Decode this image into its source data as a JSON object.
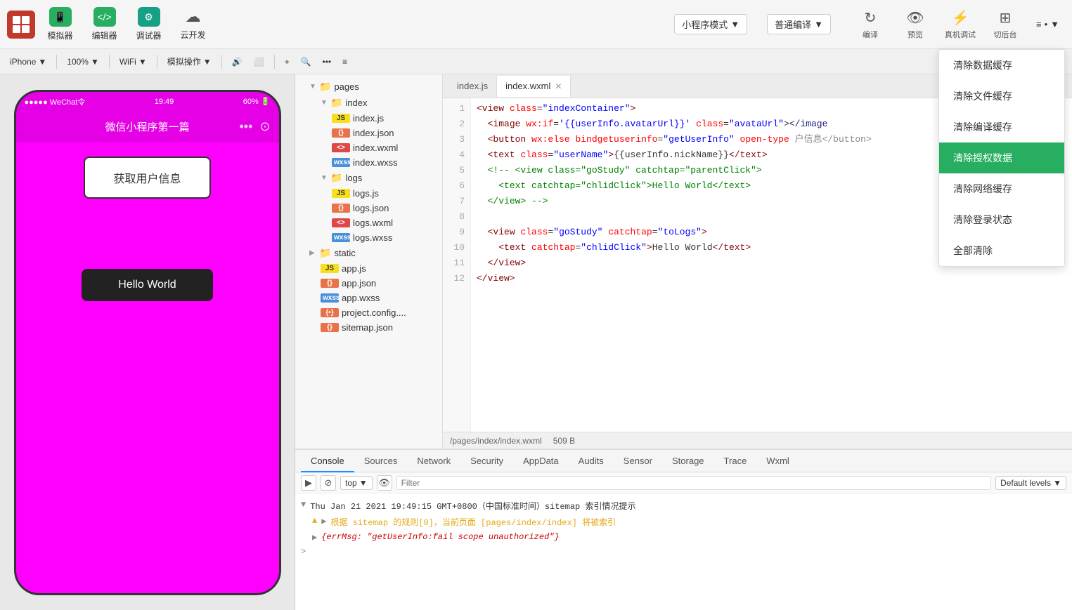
{
  "toolbar": {
    "logo": "W",
    "simulator_label": "模拟器",
    "editor_label": "编辑器",
    "debugger_label": "调试器",
    "cloud_label": "云开发",
    "mode_label": "小程序模式",
    "compile_label": "普通编译",
    "compile_icon": "▼",
    "mode_icon": "▼",
    "reload_label": "编译",
    "preview_label": "预览",
    "device_label": "真机调试",
    "backend_label": "切后台",
    "layers_label": "≡•"
  },
  "secondbar": {
    "device_label": "iPhone",
    "device_arrow": "▼",
    "zoom_label": "100%",
    "zoom_arrow": "▼",
    "network_label": "WiFi",
    "network_arrow": "▼",
    "action_label": "模拟操作",
    "action_arrow": "▼",
    "speaker_icon": "🔊",
    "expand_icon": "⬜",
    "add_icon": "+",
    "search_icon": "🔍",
    "more_icon": "...",
    "settings_icon": "≡"
  },
  "phone": {
    "status_left": "●●●●● WeChat令",
    "status_time": "19:49",
    "status_right": "60% 🔋",
    "nav_title": "微信小程序第一篇",
    "get_user_btn": "获取用户信息",
    "hello_world_btn": "Hello World"
  },
  "filetree": {
    "items": [
      {
        "level": 1,
        "type": "folder",
        "name": "pages",
        "expanded": true
      },
      {
        "level": 2,
        "type": "folder",
        "name": "index",
        "expanded": true
      },
      {
        "level": 3,
        "type": "js",
        "name": "index.js"
      },
      {
        "level": 3,
        "type": "json",
        "name": "index.json"
      },
      {
        "level": 3,
        "type": "wxml",
        "name": "index.wxml"
      },
      {
        "level": 3,
        "type": "wxss",
        "name": "index.wxss"
      },
      {
        "level": 2,
        "type": "folder",
        "name": "logs",
        "expanded": true
      },
      {
        "level": 3,
        "type": "js",
        "name": "logs.js"
      },
      {
        "level": 3,
        "type": "json",
        "name": "logs.json"
      },
      {
        "level": 3,
        "type": "wxml",
        "name": "logs.wxml"
      },
      {
        "level": 3,
        "type": "wxss",
        "name": "logs.wxss"
      },
      {
        "level": 1,
        "type": "folder",
        "name": "static",
        "expanded": false
      },
      {
        "level": 1,
        "type": "js",
        "name": "app.js"
      },
      {
        "level": 1,
        "type": "json",
        "name": "app.json"
      },
      {
        "level": 1,
        "type": "wxss",
        "name": "app.wxss"
      },
      {
        "level": 1,
        "type": "json-obj",
        "name": "project.config...."
      },
      {
        "level": 1,
        "type": "json",
        "name": "sitemap.json"
      }
    ]
  },
  "editor": {
    "tab1": "index.js",
    "tab2": "index.wxml",
    "status_path": "/pages/index/index.wxml",
    "status_size": "509 B",
    "lines": [
      {
        "num": 1,
        "code": "<span class='tag'>&lt;view</span> <span class='attr'>class</span>=<span class='val'>\"indexContainer\"</span><span class='tag'>&gt;</span>"
      },
      {
        "num": 2,
        "code": "  <span class='tag'>&lt;image</span> <span class='attr'>wx:if</span>=<span class='val'>'{{userInfo.avatarUrl}}'</span> <span class='attr'>class</span>=<span class='val'>\"avataUrl\"</span>"
      },
      {
        "num": 3,
        "code": "  <span class='tag'>&lt;button</span> <span class='attr'>wx:else</span> <span class='attr'>bindgetuserinfo</span>=<span class='val'>\"getUserInfo\"</span> <span class='attr'>open-type</span>"
      },
      {
        "num": 4,
        "code": "  <span class='tag'>&lt;text</span> <span class='attr'>class</span>=<span class='val'>\"userName\"</span><span class='tag'>&gt;</span>{{userInfo.nickName}}<span class='tag'>&lt;/text&gt;</span>"
      },
      {
        "num": 5,
        "code": "  <span class='cmt'>&lt;!-- &lt;view class=\"goStudy\" catchtap=\"parentClick\"&gt;</span>"
      },
      {
        "num": 6,
        "code": "    <span class='cmt'>  &lt;text catchtap=\"chlidClick\"&gt;Hello World&lt;/text&gt;</span>"
      },
      {
        "num": 7,
        "code": "  <span class='cmt'>  &lt;/view&gt; --&gt;</span>"
      },
      {
        "num": 8,
        "code": ""
      },
      {
        "num": 9,
        "code": "  <span class='tag'>&lt;view</span> <span class='attr'>class</span>=<span class='val'>\"goStudy\"</span> <span class='attr'>catchtap</span>=<span class='val'>\"toLogs\"</span><span class='tag'>&gt;</span>"
      },
      {
        "num": 10,
        "code": "    <span class='tag'>&lt;text</span> <span class='attr'>catchtap</span>=<span class='val'>\"chlidClick\"</span><span class='tag'>&gt;</span>Hello World<span class='tag'>&lt;/text&gt;</span>"
      },
      {
        "num": 11,
        "code": "  <span class='tag'>&lt;/view&gt;</span>"
      },
      {
        "num": 12,
        "code": "<span class='tag'>&lt;/view&gt;</span>"
      }
    ]
  },
  "bottom": {
    "tabs": [
      "Console",
      "Sources",
      "Network",
      "Security",
      "AppData",
      "Audits",
      "Sensor",
      "Storage",
      "Trace",
      "Wxml"
    ],
    "active_tab": "Console",
    "filter_placeholder": "Filter",
    "levels_label": "Default levels",
    "top_label": "top",
    "console_lines": [
      {
        "type": "info",
        "text": "▼ Thu Jan 21 2021 19:49:15 GMT+0800（中国标准时间）sitemap 索引情况提示"
      },
      {
        "type": "warn",
        "icon": "▲",
        "text": "▶ 根据 sitemap 的规则[0]，当前页面 [pages/index/index] 将被索引"
      },
      {
        "type": "error",
        "text": "▶ {errMsg: \"getUserInfo:fail scope unauthorized\"}"
      },
      {
        "type": "arrow",
        "text": ">"
      }
    ]
  },
  "dropdown": {
    "items": [
      {
        "label": "清除数据缓存",
        "highlighted": false
      },
      {
        "label": "清除文件缓存",
        "highlighted": false
      },
      {
        "label": "清除编译缓存",
        "highlighted": false
      },
      {
        "label": "清除授权数据",
        "highlighted": true
      },
      {
        "label": "清除网络缓存",
        "highlighted": false
      },
      {
        "label": "清除登录状态",
        "highlighted": false
      },
      {
        "label": "全部清除",
        "highlighted": false
      }
    ]
  }
}
